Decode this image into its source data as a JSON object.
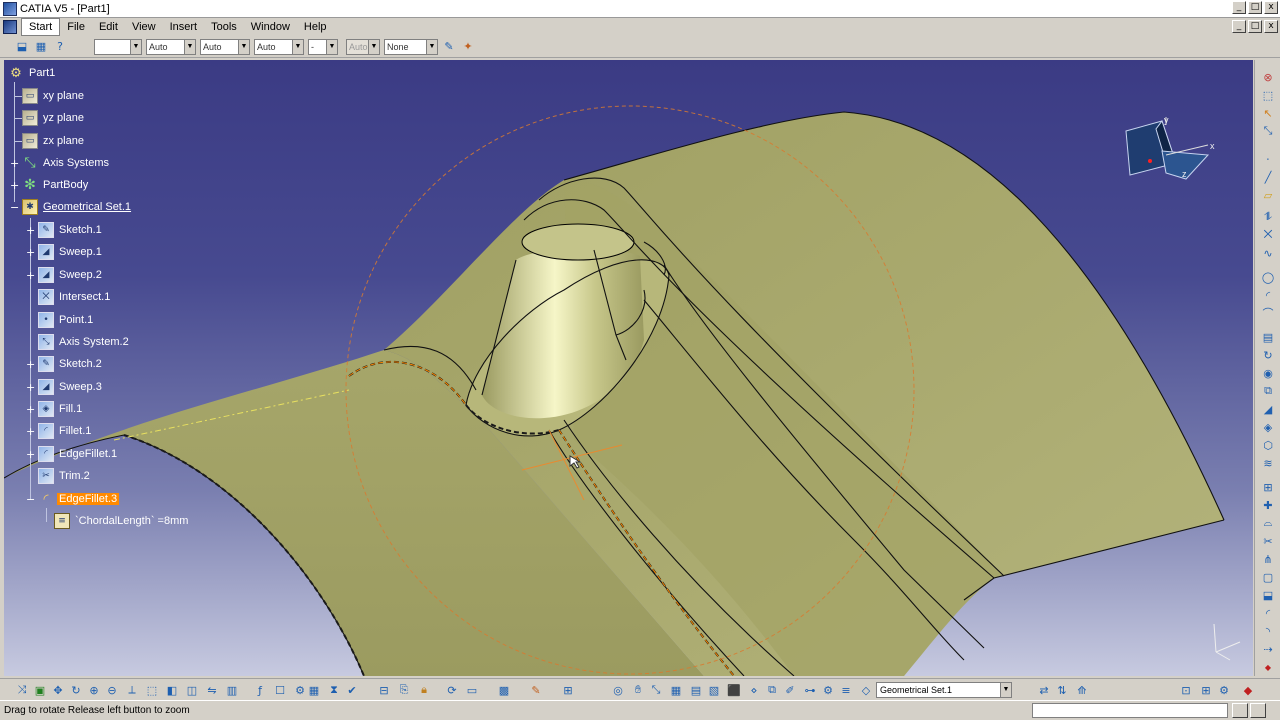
{
  "window": {
    "title": "CATIA V5 - [Part1]"
  },
  "window_controls": [
    "_",
    "□",
    "x"
  ],
  "menu": {
    "items": [
      "Start",
      "File",
      "Edit",
      "View",
      "Insert",
      "Tools",
      "Window",
      "Help"
    ]
  },
  "format_toolbar": {
    "color": "",
    "transparency": "Auto",
    "line_thickness": "Auto",
    "line_type": "Auto",
    "point_type": "-",
    "layer_state": "Auto",
    "layer": "None"
  },
  "tree": {
    "root": "Part1",
    "nodes": [
      {
        "label": "xy plane"
      },
      {
        "label": "yz plane"
      },
      {
        "label": "zx plane"
      },
      {
        "label": "Axis Systems"
      },
      {
        "label": "PartBody"
      },
      {
        "label": "Geometrical Set.1"
      },
      {
        "label": "Sketch.1"
      },
      {
        "label": "Sweep.1"
      },
      {
        "label": "Sweep.2"
      },
      {
        "label": "Intersect.1"
      },
      {
        "label": "Point.1"
      },
      {
        "label": "Axis System.2"
      },
      {
        "label": "Sketch.2"
      },
      {
        "label": "Sweep.3"
      },
      {
        "label": "Fill.1"
      },
      {
        "label": "Fillet.1"
      },
      {
        "label": "EdgeFillet.1"
      },
      {
        "label": "Trim.2"
      },
      {
        "label": "EdgeFillet.3"
      },
      {
        "label": "`ChordalLength` =8mm"
      }
    ]
  },
  "compass": {
    "x": "x",
    "y": "y",
    "z": "z"
  },
  "bottom_toolbar": {
    "current_set": "Geometrical Set.1"
  },
  "status": {
    "message": "Drag to rotate  Release left button to zoom"
  },
  "colors": {
    "background_top": "#3b3b84",
    "background_bottom": "#c7cae0",
    "surface": "#a8a86a",
    "highlight": "#ff8a00"
  }
}
